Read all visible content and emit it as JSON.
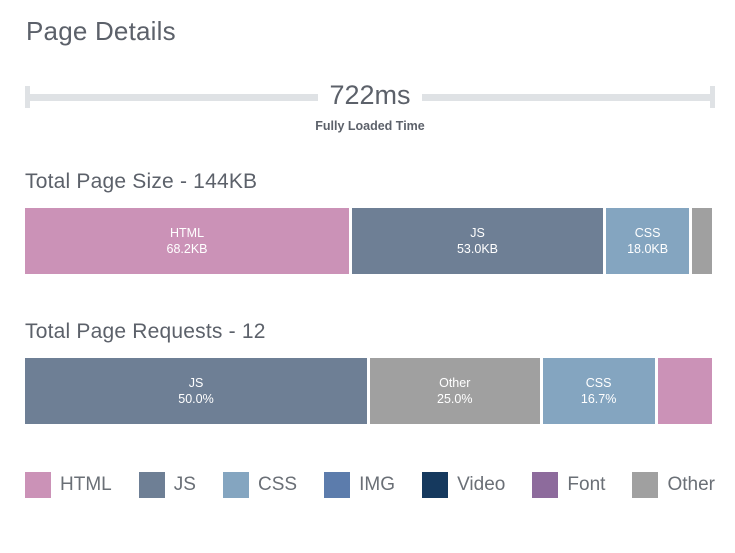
{
  "page_title": "Page Details",
  "fully_loaded": {
    "value": "722ms",
    "label": "Fully Loaded Time"
  },
  "page_size": {
    "title": "Total Page Size - 144KB",
    "segments": [
      {
        "name": "HTML",
        "value": "68.2KB",
        "color": "#cb92b7",
        "percent": 47.4,
        "show_text": true
      },
      {
        "name": "JS",
        "value": "53.0KB",
        "color": "#6e7f95",
        "percent": 36.8,
        "show_text": true
      },
      {
        "name": "CSS",
        "value": "18.0KB",
        "color": "#84a5c0",
        "percent": 12.5,
        "show_text": true
      },
      {
        "name": "Other",
        "value": "",
        "color": "#a0a0a0",
        "percent": 3.3,
        "show_text": false
      }
    ]
  },
  "page_requests": {
    "title": "Total Page Requests - 12",
    "segments": [
      {
        "name": "JS",
        "value": "50.0%",
        "color": "#6e7f95",
        "percent": 50.0,
        "show_text": true
      },
      {
        "name": "Other",
        "value": "25.0%",
        "color": "#a0a0a0",
        "percent": 25.0,
        "show_text": true
      },
      {
        "name": "CSS",
        "value": "16.7%",
        "color": "#84a5c0",
        "percent": 16.7,
        "show_text": true
      },
      {
        "name": "HTML",
        "value": "8.3%",
        "color": "#cb92b7",
        "percent": 8.3,
        "show_text": false
      }
    ]
  },
  "legend": [
    {
      "label": "HTML",
      "color": "#cb92b7"
    },
    {
      "label": "JS",
      "color": "#6e7f95"
    },
    {
      "label": "CSS",
      "color": "#84a5c0"
    },
    {
      "label": "IMG",
      "color": "#5c7cac"
    },
    {
      "label": "Video",
      "color": "#15395e"
    },
    {
      "label": "Font",
      "color": "#8d6b9c"
    },
    {
      "label": "Other",
      "color": "#a0a0a0"
    }
  ],
  "chart_data": {
    "type": "bar",
    "title": "Page Details",
    "charts": [
      {
        "name": "Fully Loaded Time",
        "type": "scalar",
        "value": 722,
        "unit": "ms",
        "display": "722ms"
      },
      {
        "name": "Total Page Size",
        "type": "bar",
        "orientation": "horizontal-stacked",
        "total": "144KB",
        "total_value": 144,
        "unit": "KB",
        "categories": [
          "HTML",
          "JS",
          "CSS",
          "Other"
        ],
        "values": [
          68.2,
          53.0,
          18.0,
          4.8
        ],
        "labels": [
          "68.2KB",
          "53.0KB",
          "18.0KB",
          ""
        ],
        "colors": [
          "#cb92b7",
          "#6e7f95",
          "#84a5c0",
          "#a0a0a0"
        ]
      },
      {
        "name": "Total Page Requests",
        "type": "bar",
        "orientation": "horizontal-stacked",
        "total": "12",
        "total_value": 12,
        "unit": "requests",
        "categories": [
          "JS",
          "Other",
          "CSS",
          "HTML"
        ],
        "values": [
          50.0,
          25.0,
          16.7,
          8.3
        ],
        "labels": [
          "50.0%",
          "25.0%",
          "16.7%",
          ""
        ],
        "colors": [
          "#6e7f95",
          "#a0a0a0",
          "#84a5c0",
          "#cb92b7"
        ]
      }
    ],
    "legend_position": "bottom",
    "grid": false
  }
}
